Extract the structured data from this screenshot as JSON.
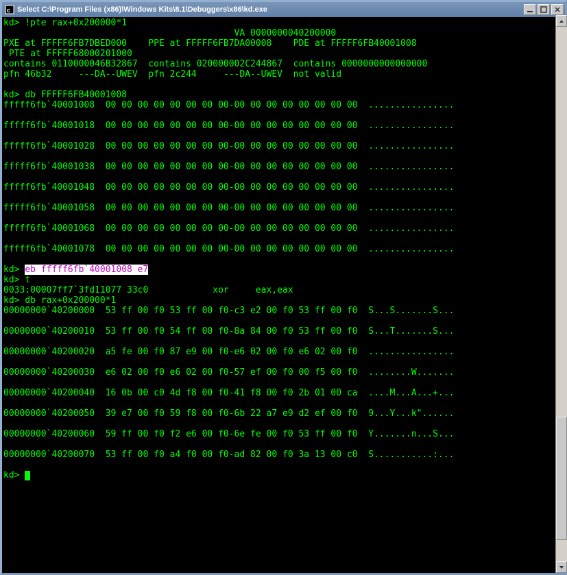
{
  "window": {
    "title": "Select C:\\Program Files (x86)\\Windows Kits\\8.1\\Debuggers\\x86\\kd.exe"
  },
  "terminal": {
    "prompt": "kd>",
    "cmd_pte": "!pte rax+0x200000*1",
    "pte_out_l1": "                                           VA 0000000040200000",
    "pte_out_l2": "PXE at FFFFF6FB7DBED000    PPE at FFFFF6FB7DA00008    PDE at FFFFF6FB40001008",
    "pte_out_l3": " PTE at FFFFF68000201000",
    "pte_out_l4": "contains 0110000046B32867  contains 020000002C244867  contains 0000000000000000",
    "pte_out_l5": "pfn 46b32     ---DA--UWEV  pfn 2c244     ---DA--UWEV  not valid",
    "cmd_db1": "db FFFFF6FB40001008",
    "db1": [
      {
        "addr": "fffff6fb`40001008",
        "hex": "00 00 00 00 00 00 00 00-00 00 00 00 00 00 00 00",
        "asc": "................"
      },
      {
        "addr": "fffff6fb`40001018",
        "hex": "00 00 00 00 00 00 00 00-00 00 00 00 00 00 00 00",
        "asc": "................"
      },
      {
        "addr": "fffff6fb`40001028",
        "hex": "00 00 00 00 00 00 00 00-00 00 00 00 00 00 00 00",
        "asc": "................"
      },
      {
        "addr": "fffff6fb`40001038",
        "hex": "00 00 00 00 00 00 00 00-00 00 00 00 00 00 00 00",
        "asc": "................"
      },
      {
        "addr": "fffff6fb`40001048",
        "hex": "00 00 00 00 00 00 00 00-00 00 00 00 00 00 00 00",
        "asc": "................"
      },
      {
        "addr": "fffff6fb`40001058",
        "hex": "00 00 00 00 00 00 00 00-00 00 00 00 00 00 00 00",
        "asc": "................"
      },
      {
        "addr": "fffff6fb`40001068",
        "hex": "00 00 00 00 00 00 00 00-00 00 00 00 00 00 00 00",
        "asc": "................"
      },
      {
        "addr": "fffff6fb`40001078",
        "hex": "00 00 00 00 00 00 00 00-00 00 00 00 00 00 00 00",
        "asc": "................"
      }
    ],
    "cmd_eb": "eb fffff6fb`40001008 e7",
    "cmd_t": "t",
    "t_out": "0033:00007ff7`3fd11077 33c0            xor     eax,eax",
    "cmd_db2": "db rax+0x200000*1",
    "db2": [
      {
        "addr": "00000000`40200000",
        "hex": "53 ff 00 f0 53 ff 00 f0-c3 e2 00 f0 53 ff 00 f0",
        "asc": "S...S.......S..."
      },
      {
        "addr": "00000000`40200010",
        "hex": "53 ff 00 f0 54 ff 00 f0-8a 84 00 f0 53 ff 00 f0",
        "asc": "S...T.......S..."
      },
      {
        "addr": "00000000`40200020",
        "hex": "a5 fe 00 f0 87 e9 00 f0-e6 02 00 f0 e6 02 00 f0",
        "asc": "................"
      },
      {
        "addr": "00000000`40200030",
        "hex": "e6 02 00 f0 e6 02 00 f0-57 ef 00 f0 00 f5 00 f0",
        "asc": "........W......."
      },
      {
        "addr": "00000000`40200040",
        "hex": "16 0b 00 c0 4d f8 00 f0-41 f8 00 f0 2b 01 00 ca",
        "asc": "....M...A...+..."
      },
      {
        "addr": "00000000`40200050",
        "hex": "39 e7 00 f0 59 f8 00 f0-6b 22 a7 e9 d2 ef 00 f0",
        "asc": "9...Y...k\"......"
      },
      {
        "addr": "00000000`40200060",
        "hex": "59 ff 00 f0 f2 e6 00 f0-6e fe 00 f0 53 ff 00 f0",
        "asc": "Y.......n...S..."
      },
      {
        "addr": "00000000`40200070",
        "hex": "53 ff 00 f0 a4 f0 00 f0-ad 82 00 f0 3a 13 00 c0",
        "asc": "S...........:..."
      }
    ]
  }
}
